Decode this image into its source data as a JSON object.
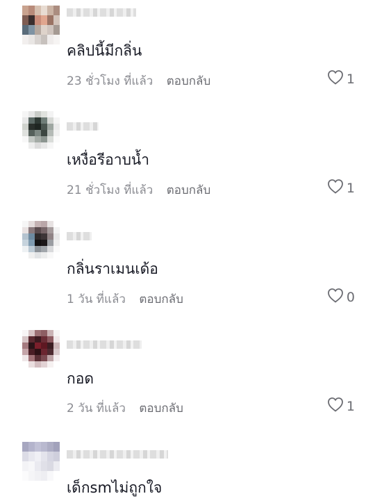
{
  "comments": [
    {
      "text": "คลิปนี้มีกลิ่น",
      "time": "23 ชั่วโมง ที่แล้ว",
      "reply_label": "ตอบกลับ",
      "likes": "1",
      "avatar_colors": [
        "#c9a38f",
        "#b88b7a",
        "#d6c0b0",
        "#e8dcd2",
        "#cbb4a5",
        "#ab8d80",
        "#7e5c52",
        "#3a2e2e",
        "#c98c7a",
        "#e0a68f",
        "#9a7364",
        "#d3c4bb",
        "#5a6c7a",
        "#7f93a3",
        "#b5a89f",
        "#ded3cb",
        "#cfc4be",
        "#a59a93",
        "#f2efee",
        "#e9e6e4",
        "#d8d3d0",
        "#c7c1bd",
        "#efeceb",
        "#f6f4f3"
      ]
    },
    {
      "text": "เหงื่อรีอาบน้ำ",
      "time": "21 ชั่วโมง ที่แล้ว",
      "reply_label": "ตอบกลับ",
      "likes": "1",
      "avatar_colors": [
        "#f5f5f5",
        "#e6e6e6",
        "#c9ccc8",
        "#e0e2de",
        "#f3f3f3",
        "#ffffff",
        "#e8e8e8",
        "#5d6b67",
        "#2f3a35",
        "#6f7d78",
        "#d6d8d5",
        "#f4f4f4",
        "#cfd2cd",
        "#2a302c",
        "#1f2622",
        "#4a5550",
        "#9ea6a1",
        "#e9e9e9",
        "#dfe1de",
        "#55605b",
        "#7c8782",
        "#3c4641",
        "#b4bab6",
        "#f0f0f0",
        "#f7f7f7",
        "#c2c7c3",
        "#a4aba6",
        "#8c9590",
        "#d9dcd9",
        "#fbfbfb",
        "#ffffff",
        "#eeeeee",
        "#dcdcdc",
        "#e7e7e7",
        "#f6f6f6",
        "#ffffff"
      ]
    },
    {
      "text": "กลิ่นราเมนเด้อ",
      "time": "1 วัน ที่แล้ว",
      "reply_label": "ตอบกลับ",
      "likes": "0",
      "avatar_colors": [
        "#f6f6f6",
        "#e4dcdc",
        "#c4b2b3",
        "#b9a6a8",
        "#e7e2e2",
        "#ffffff",
        "#e9e2e2",
        "#8a7a7d",
        "#5b4c4f",
        "#766568",
        "#a59b9c",
        "#f2f2f2",
        "#b4c3cf",
        "#6d8aa0",
        "#2f2a2b",
        "#3d3537",
        "#8f8385",
        "#e6e6e6",
        "#c6d3dd",
        "#7f9bb0",
        "#121011",
        "#1b1718",
        "#9a9da2",
        "#eeeeee",
        "#eef1f3",
        "#bccad5",
        "#8d9399",
        "#a1a6ab",
        "#d9dadc",
        "#fafafa",
        "#ffffff",
        "#f0f0f0",
        "#e2e4e6",
        "#eceded",
        "#f8f8f8",
        "#ffffff"
      ]
    },
    {
      "text": "กอด",
      "time": "2 วัน ที่แล้ว",
      "reply_label": "ตอบกลับ",
      "likes": "1",
      "avatar_colors": [
        "#f8f5f5",
        "#d6c3c4",
        "#9b6f73",
        "#8d5e63",
        "#c9b2b4",
        "#f6f3f3",
        "#d7c5c6",
        "#5b2a31",
        "#3b1a20",
        "#6a2d36",
        "#8c5a60",
        "#efe6e7",
        "#a57a7f",
        "#2a1418",
        "#7a1f2b",
        "#5e1822",
        "#3b1d22",
        "#cbb6b8",
        "#c4a4a8",
        "#4a1e25",
        "#2d1216",
        "#6b2630",
        "#4d2a30",
        "#d8c9cb",
        "#efe7e8",
        "#a17277",
        "#5a3036",
        "#7a4a51",
        "#bca2a5",
        "#f4eeef",
        "#ffffff",
        "#eadedf",
        "#d3bdc0",
        "#e2d2d4",
        "#f6f1f1",
        "#ffffff"
      ]
    },
    {
      "text": "เด็กsmไม่ถูกใจ",
      "likes": "",
      "avatar_colors": [
        "#a7a7c0",
        "#b4b4cc",
        "#c1c1d6",
        "#b9b9cf",
        "#adadc4",
        "#a2a2bb",
        "#dcdce6",
        "#e8e8ef",
        "#f0f0f5",
        "#e4e4ec",
        "#d6d6e2",
        "#cfcfdc",
        "#f3f3f6",
        "#f7f7f9",
        "#eaeaf0",
        "#e0e0e8",
        "#dadae3",
        "#ececf1",
        "#fbfbfc",
        "#f5f5f7",
        "#f1f1f4",
        "#eeeeF2",
        "#f8f8fa",
        "#ffffff"
      ]
    }
  ]
}
